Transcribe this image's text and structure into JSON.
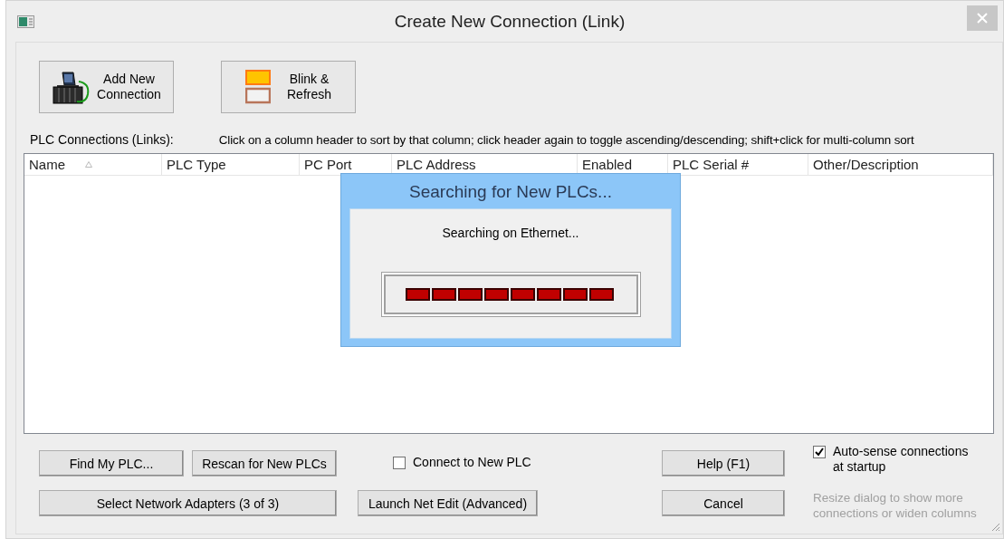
{
  "window": {
    "title": "Create New Connection (Link)"
  },
  "toolbar": [
    {
      "kind": "add",
      "lines": [
        "Add New",
        "Connection"
      ]
    },
    {
      "kind": "blink",
      "lines": [
        "Blink &",
        "Refresh"
      ]
    }
  ],
  "connections_label": "PLC Connections (Links):",
  "sort_hint": "Click on a column header to sort by that column; click header again to toggle ascending/descending; shift+click for multi-column sort",
  "table": {
    "columns": [
      {
        "label": "Name",
        "sorted": true
      },
      {
        "label": "PLC Type",
        "sorted": false
      },
      {
        "label": "PC Port",
        "sorted": false
      },
      {
        "label": "PLC Address",
        "sorted": false
      },
      {
        "label": "Enabled",
        "sorted": false
      },
      {
        "label": "PLC Serial #",
        "sorted": false
      },
      {
        "label": "Other/Description",
        "sorted": false
      }
    ]
  },
  "progress_dialog": {
    "title": "Searching for New PLCs...",
    "message": "Searching on Ethernet..."
  },
  "find_button": "Find My PLC...",
  "rescan_button": "Rescan for New PLCs",
  "connect_checkbox": {
    "label": "Connect to New PLC",
    "checked": false
  },
  "help_button": "Help (F1)",
  "autosense_checkbox": {
    "label": "Auto-sense connections at startup",
    "checked": true
  },
  "adapters_button": "Select Network Adapters (3 of 3)",
  "net_edit_button": "Launch Net Edit (Advanced)",
  "cancel_button": "Cancel",
  "resize_hint": "Resize dialog to show more connections or widen columns"
}
